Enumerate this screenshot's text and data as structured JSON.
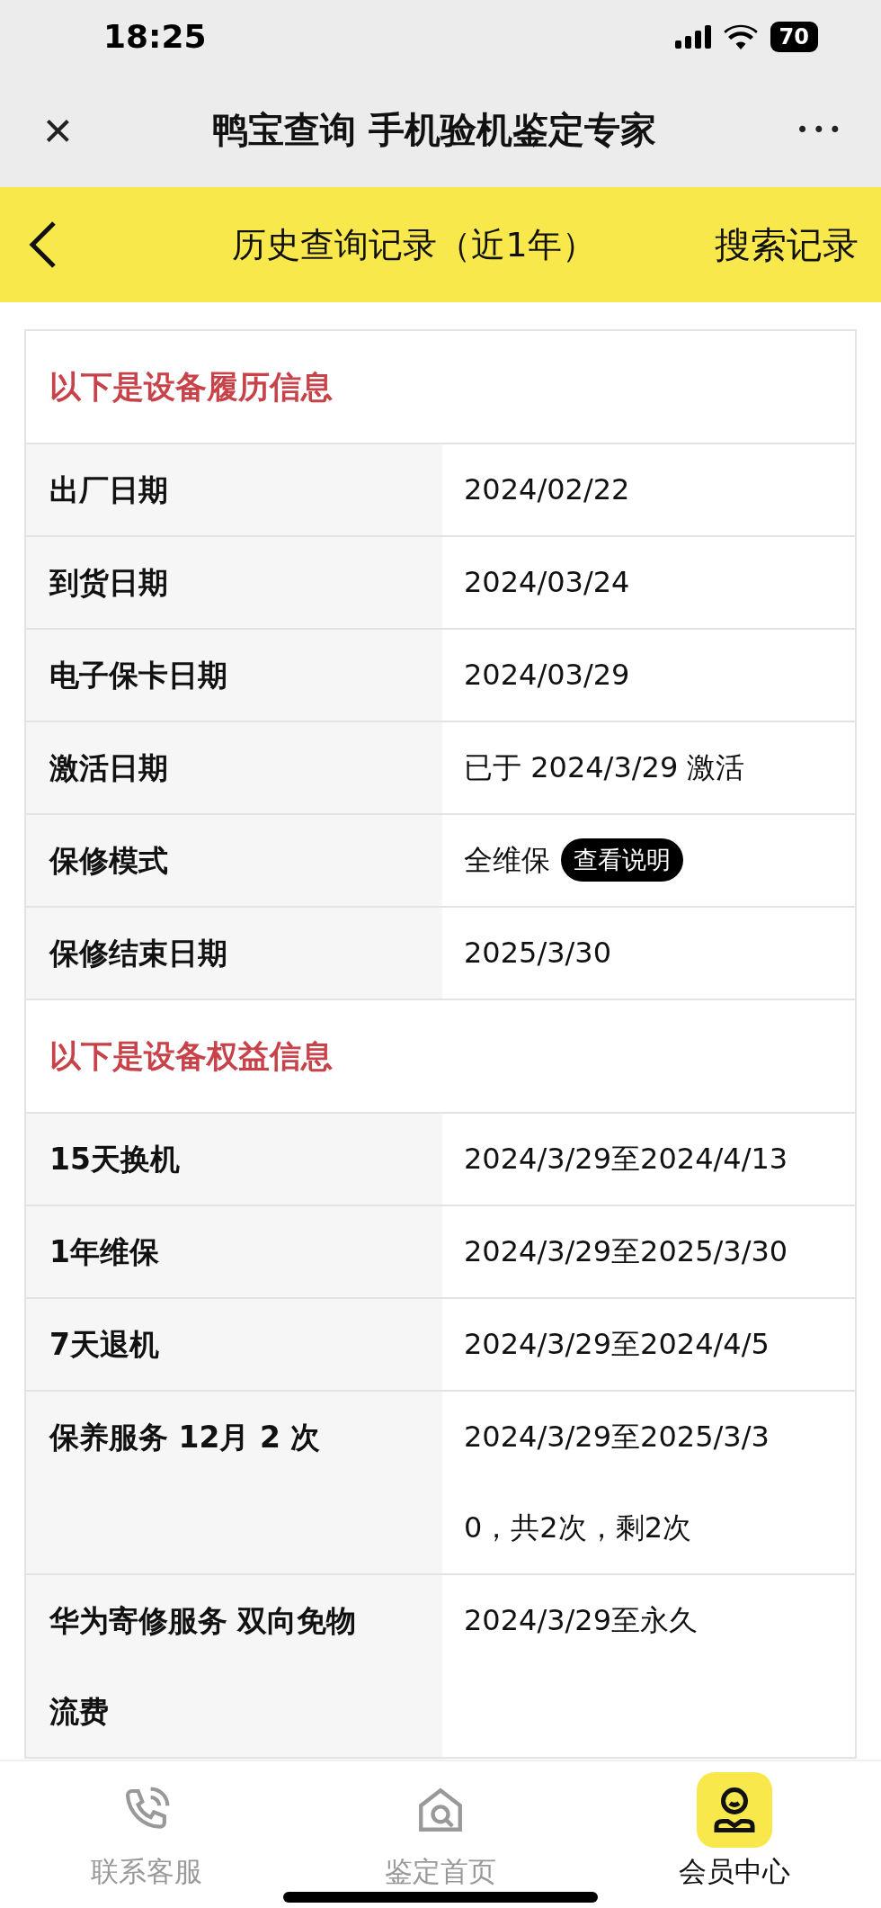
{
  "status_bar": {
    "time": "18:25",
    "battery": "70"
  },
  "window": {
    "close": "×",
    "title": "鸭宝查询 手机验机鉴定专家",
    "more": "•••"
  },
  "header": {
    "title": "历史查询记录（近1年）",
    "action": "搜索记录"
  },
  "sections": [
    {
      "title": "以下是设备履历信息",
      "rows": [
        {
          "label": "出厂日期",
          "value": "2024/02/22"
        },
        {
          "label": "到货日期",
          "value": "2024/03/24"
        },
        {
          "label": "电子保卡日期",
          "value": "2024/03/29"
        },
        {
          "label": "激活日期",
          "value": "已于 2024/3/29 激活"
        },
        {
          "label": "保修模式",
          "value": "全维保",
          "badge": "查看说明"
        },
        {
          "label": "保修结束日期",
          "value": "2025/3/30"
        }
      ]
    },
    {
      "title": "以下是设备权益信息",
      "rows": [
        {
          "label": "15天换机",
          "value": "2024/3/29至2024/4/13"
        },
        {
          "label": "1年维保",
          "value": "2024/3/29至2025/3/30"
        },
        {
          "label": "7天退机",
          "value": "2024/3/29至2024/4/5"
        },
        {
          "label": "保养服务 12月 2 次",
          "value": "2024/3/29至2025/3/30，共2次，剩2次"
        },
        {
          "label": "华为寄修服务 双向免物流费",
          "value": "2024/3/29至永久"
        }
      ]
    }
  ],
  "tab_bar": [
    {
      "kind": "phone",
      "label": "联系客服",
      "selected": false
    },
    {
      "kind": "home",
      "label": "鉴定首页",
      "selected": false
    },
    {
      "kind": "member",
      "label": "会员中心",
      "selected": true
    }
  ]
}
